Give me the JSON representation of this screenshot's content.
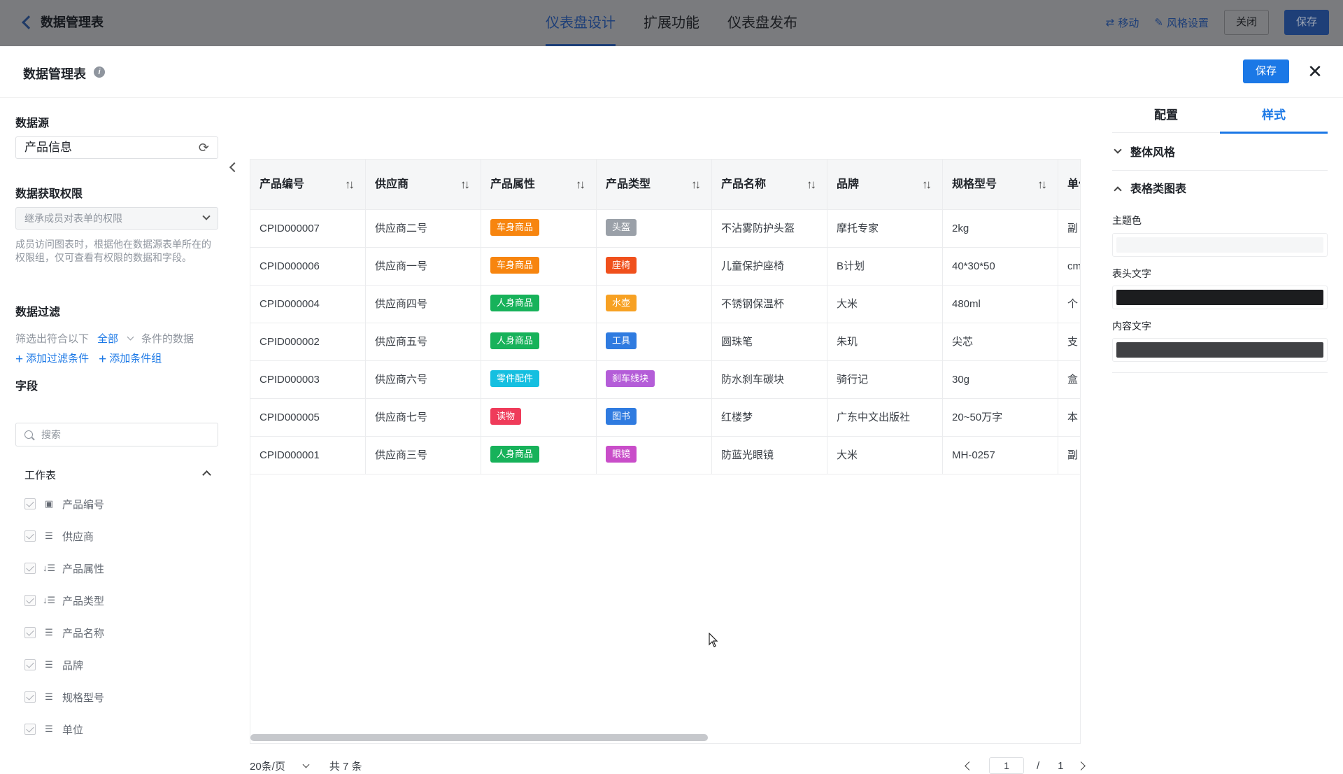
{
  "topbar": {
    "back_title": "数据管理表",
    "tabs": [
      {
        "label": "仪表盘设计",
        "active": true
      },
      {
        "label": "扩展功能",
        "active": false
      },
      {
        "label": "仪表盘发布",
        "active": false
      }
    ],
    "move_label": "移动",
    "style_label": "风格设置",
    "close_label": "关闭",
    "save_label": "保存"
  },
  "modal": {
    "title": "数据管理表",
    "save_label": "保存",
    "close_glyph": "✕"
  },
  "left": {
    "datasource_title": "数据源",
    "datasource_value": "产品信息",
    "permission_title": "数据获取权限",
    "permission_value": "继承成员对表单的权限",
    "permission_desc": "成员访问图表时，根据他在数据源表单所在的权限组，仅可查看有权限的数据和字段。",
    "filter_title": "数据过滤",
    "filter_prefix": "筛选出符合以下",
    "filter_scope": "全部",
    "filter_suffix": "条件的数据",
    "add_filter": "添加过滤条件",
    "add_group": "添加条件组",
    "fields_title": "字段",
    "search_placeholder": "搜索",
    "worksheet_label": "工作表",
    "fields": [
      {
        "label": "产品编号",
        "icon": "id-field-icon"
      },
      {
        "label": "供应商",
        "icon": "text-field-icon"
      },
      {
        "label": "产品属性",
        "icon": "select-field-icon"
      },
      {
        "label": "产品类型",
        "icon": "select-field-icon"
      },
      {
        "label": "产品名称",
        "icon": "text-field-icon"
      },
      {
        "label": "品牌",
        "icon": "text-field-icon"
      },
      {
        "label": "规格型号",
        "icon": "text-field-icon"
      },
      {
        "label": "单位",
        "icon": "text-field-icon"
      }
    ]
  },
  "table": {
    "columns": [
      "产品编号",
      "供应商",
      "产品属性",
      "产品类型",
      "产品名称",
      "品牌",
      "规格型号",
      "单位"
    ],
    "rows": [
      {
        "id": "CPID000007",
        "supplier": "供应商二号",
        "attr": {
          "label": "车身商品",
          "color": "#f7850f"
        },
        "type": {
          "label": "头盔",
          "color": "#9aa0a8"
        },
        "name": "不沾雾防护头盔",
        "brand": "摩托专家",
        "spec": "2kg",
        "unit": "副"
      },
      {
        "id": "CPID000006",
        "supplier": "供应商一号",
        "attr": {
          "label": "车身商品",
          "color": "#f7850f"
        },
        "type": {
          "label": "座椅",
          "color": "#f0501c"
        },
        "name": "儿童保护座椅",
        "brand": "B计划",
        "spec": "40*30*50",
        "unit": "cm"
      },
      {
        "id": "CPID000004",
        "supplier": "供应商四号",
        "attr": {
          "label": "人身商品",
          "color": "#17b25a"
        },
        "type": {
          "label": "水壶",
          "color": "#f7a123"
        },
        "name": "不锈钢保温杯",
        "brand": "大米",
        "spec": "480ml",
        "unit": "个"
      },
      {
        "id": "CPID000002",
        "supplier": "供应商五号",
        "attr": {
          "label": "人身商品",
          "color": "#17b25a"
        },
        "type": {
          "label": "工具",
          "color": "#2f7be0"
        },
        "name": "圆珠笔",
        "brand": "朱玑",
        "spec": "尖芯",
        "unit": "支"
      },
      {
        "id": "CPID000003",
        "supplier": "供应商六号",
        "attr": {
          "label": "零件配件",
          "color": "#15bfe0"
        },
        "type": {
          "label": "刹车线块",
          "color": "#b45dd8"
        },
        "name": "防水刹车碳块",
        "brand": "骑行记",
        "spec": "30g",
        "unit": "盒"
      },
      {
        "id": "CPID000005",
        "supplier": "供应商七号",
        "attr": {
          "label": "读物",
          "color": "#ef3b5a"
        },
        "type": {
          "label": "图书",
          "color": "#2f7be0"
        },
        "name": "红楼梦",
        "brand": "广东中文出版社",
        "spec": "20~50万字",
        "unit": "本"
      },
      {
        "id": "CPID000001",
        "supplier": "供应商三号",
        "attr": {
          "label": "人身商品",
          "color": "#17b25a"
        },
        "type": {
          "label": "眼镜",
          "color": "#c94dc9"
        },
        "name": "防蓝光眼镜",
        "brand": "大米",
        "spec": "MH-0257",
        "unit": "副"
      }
    ]
  },
  "pager": {
    "page_size": "20条/页",
    "total": "共 7 条",
    "current": "1",
    "separator": "/",
    "pages": "1"
  },
  "right": {
    "tabs": [
      {
        "label": "配置",
        "active": false
      },
      {
        "label": "样式",
        "active": true
      }
    ],
    "overall_style": "整体风格",
    "table_chart": "表格类图表",
    "theme_color_label": "主题色",
    "theme_color": "#f5f6f7",
    "header_text_label": "表头文字",
    "header_text_color": "#1c1d1f",
    "content_text_label": "内容文字",
    "content_text_color": "#404144"
  }
}
